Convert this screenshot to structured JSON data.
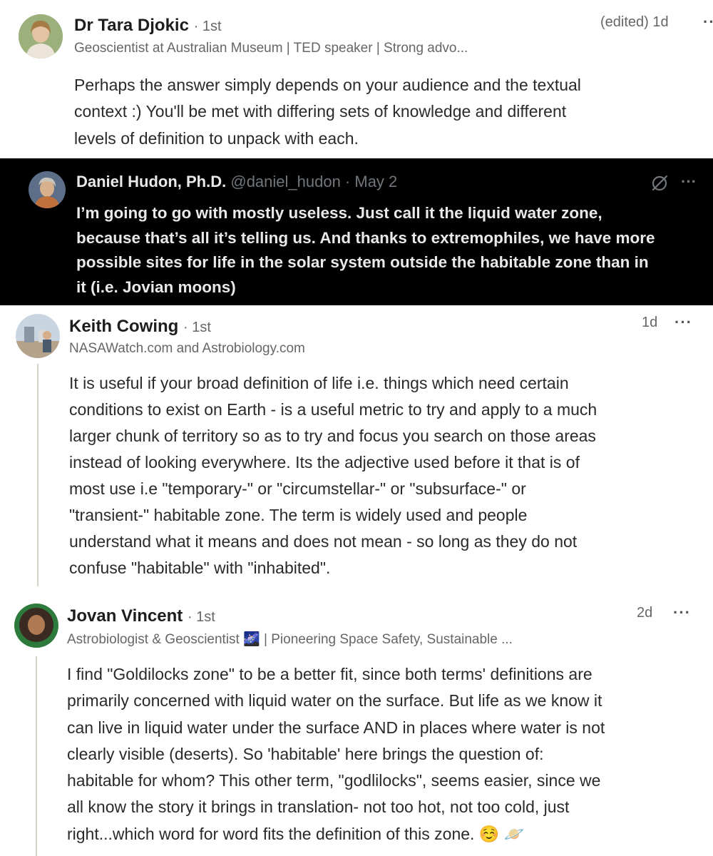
{
  "comments": [
    {
      "author": "Dr Tara Djokic",
      "degree": "· 1st",
      "headline": "Geoscientist at Australian Museum | TED speaker | Strong advo...",
      "time": "(edited) 1d",
      "menu": "···",
      "lines": [
        "Perhaps the answer simply depends on your audience and the textual",
        "context :) You'll be met with differing sets of knowledge and different",
        "levels of definition to unpack with each."
      ]
    },
    {
      "author": "Keith Cowing",
      "degree": "· 1st",
      "headline": "NASAWatch.com and Astrobiology.com",
      "time": "1d",
      "menu": "···",
      "lines": [
        "It is useful if your broad definition of life i.e. things which need certain",
        "conditions to exist on Earth - is a useful metric to try and apply to a much",
        "larger chunk of territory so as to try and focus you search on those areas",
        "instead of looking everywhere. Its the adjective used before it that is of",
        "most use i.e \"temporary-\" or \"circumstellar-\" or \"subsurface-\" or",
        "\"transient-\" habitable zone. The term is widely used and people",
        "understand what it means and does not mean - so long as they do not",
        "confuse \"habitable\" with \"inhabited\"."
      ]
    },
    {
      "author": "Jovan Vincent",
      "degree": "· 1st",
      "headline": "Astrobiologist & Geoscientist 🌌 | Pioneering Space Safety, Sustainable ...",
      "time": "2d",
      "menu": "···",
      "lines": [
        "I find \"Goldilocks zone\" to be a better fit, since both terms' definitions are",
        "primarily concerned with liquid water on the surface. But life as we know it",
        "can live in liquid water under the surface AND in places where water is not",
        "clearly visible (deserts). So 'habitable' here brings the question of:",
        "habitable for whom? This other term, \"godlilocks\", seems easier, since we",
        "all know the story it brings in translation- not too hot, not too cold, just",
        "right...which word for word fits the definition of this zone. ☺️ 🪐"
      ]
    }
  ],
  "tweet": {
    "name": "Daniel Hudon, Ph.D.",
    "handle_date": "@daniel_hudon · May 2",
    "menu": "···",
    "lines": [
      "I’m going to go with mostly useless. Just call it the liquid water zone,",
      "because that’s all it’s telling us. And thanks to extremophiles, we have more",
      "possible sites for life in the solar system outside the habitable zone than in",
      "it (i.e. Jovian moons)"
    ]
  }
}
